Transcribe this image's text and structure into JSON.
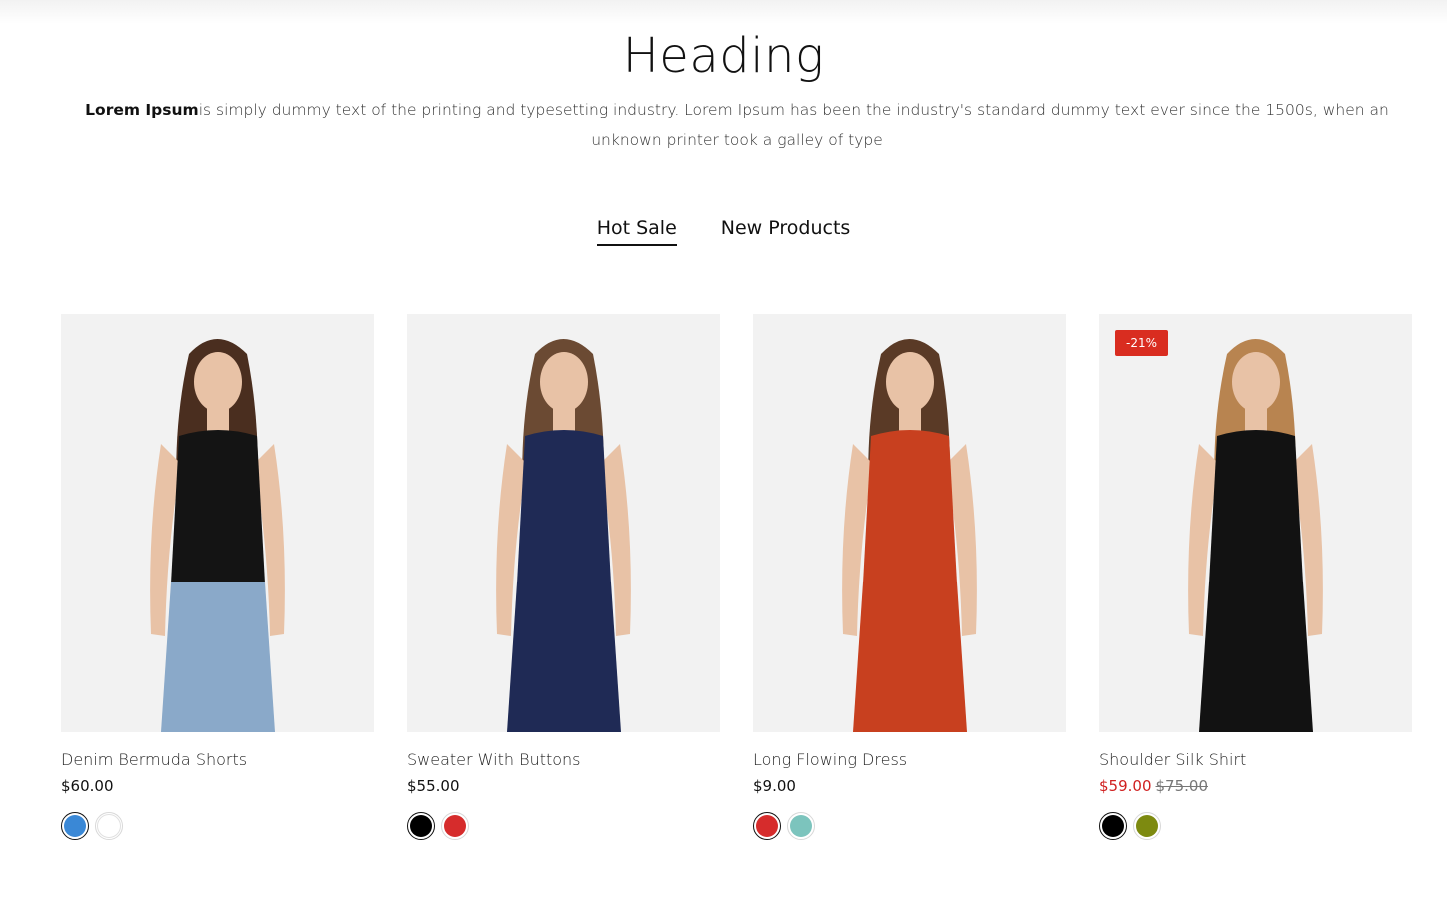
{
  "section": {
    "heading": "Heading",
    "intro_bold": "Lorem Ipsum",
    "intro_text": "is simply dummy text of the printing and typesetting industry. Lorem Ipsum has been the industry's standard dummy text ever since the 1500s, when an unknown printer took a galley of type"
  },
  "tabs": [
    {
      "label": "Hot Sale",
      "active": true
    },
    {
      "label": "New Products",
      "active": false
    }
  ],
  "products": [
    {
      "name": "Denim Bermuda Shorts",
      "price": "$60.00",
      "old_price": "",
      "badge": "",
      "top_color": "#141414",
      "bottom_color": "#8aa9c9",
      "hair_color": "#4a2e1f",
      "swatches": [
        "#3a88d6",
        "#ffffff"
      ]
    },
    {
      "name": "Sweater With Buttons",
      "price": "$55.00",
      "old_price": "",
      "badge": "",
      "top_color": "#1f2a55",
      "bottom_color": "#1f2a55",
      "hair_color": "#6b4a33",
      "swatches": [
        "#000000",
        "#d62c2c"
      ]
    },
    {
      "name": "Long Flowing Dress",
      "price": "$9.00",
      "old_price": "",
      "badge": "",
      "top_color": "#c8401f",
      "bottom_color": "#c8401f",
      "hair_color": "#5a3a26",
      "swatches": [
        "#d62c2c",
        "#7cc4bd"
      ]
    },
    {
      "name": "Shoulder Silk Shirt",
      "price": "$59.00",
      "old_price": "$75.00",
      "badge": "-21%",
      "top_color": "#121212",
      "bottom_color": "#121212",
      "hair_color": "#b88450",
      "swatches": [
        "#000000",
        "#7d8a10"
      ]
    }
  ]
}
